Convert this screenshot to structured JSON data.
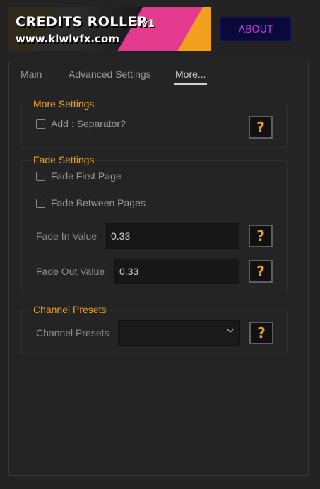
{
  "banner": {
    "title": "CREDITS ROLLER",
    "version": "v1",
    "url": "www.klwlvfx.com"
  },
  "about_button": {
    "label": "ABOUT"
  },
  "tabs": [
    {
      "label": "Main",
      "active": false
    },
    {
      "label": "Advanced Settings",
      "active": false
    },
    {
      "label": "More...",
      "active": true
    }
  ],
  "more_settings": {
    "title": "More Settings",
    "add_separator": {
      "label": "Add : Separator?",
      "checked": false
    },
    "help_label": "?"
  },
  "fade_settings": {
    "title": "Fade Settings",
    "fade_first_page": {
      "label": "Fade First Page",
      "checked": false
    },
    "fade_between_pages": {
      "label": "Fade Between Pages",
      "checked": false
    },
    "fade_in": {
      "label": "Fade In Value",
      "value": "0.33"
    },
    "fade_out": {
      "label": "Fade Out Value",
      "value": "0.33"
    },
    "help_label": "?"
  },
  "channel_presets": {
    "title": "Channel Presets",
    "label": "Channel Presets",
    "selected": "",
    "help_label": "?"
  },
  "colors": {
    "accent": "#f0a21c",
    "about_text": "#c23cdc",
    "about_bg": "#0a0a3a",
    "background": "#232323"
  }
}
